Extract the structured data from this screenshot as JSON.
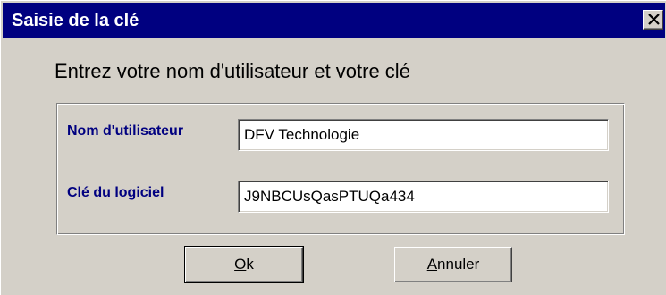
{
  "window": {
    "title": "Saisie de la clé",
    "close_glyph": "✕"
  },
  "heading": "Entrez votre nom d'utilisateur et votre clé",
  "form": {
    "username_label": "Nom d'utilisateur",
    "username_value": "DFV Technologie",
    "key_label": "Clé du logiciel",
    "key_value": "J9NBCUsQasPTUQa434"
  },
  "buttons": {
    "ok_accel": "O",
    "ok_rest": "k",
    "cancel_accel": "A",
    "cancel_rest": "nnuler"
  },
  "colors": {
    "titlebar": "#000080",
    "dialog_bg": "#d4d0c8",
    "label_text": "#000080"
  },
  "icons": [
    "close-icon"
  ]
}
